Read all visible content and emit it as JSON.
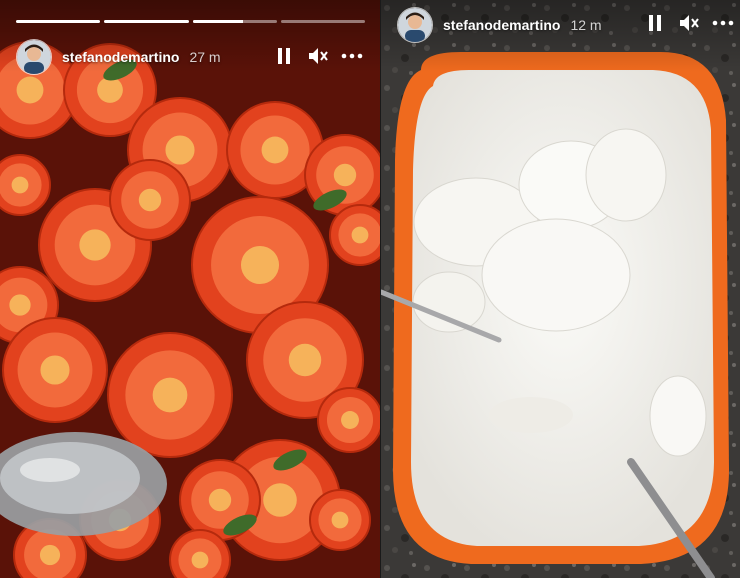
{
  "stories": [
    {
      "username": "stefanodemartino",
      "time_ago": "27 m",
      "progress_segments": [
        1,
        1,
        0.6,
        0
      ],
      "media_description_icon": "tomato-salad-photo",
      "controls": [
        "pause-icon",
        "mute-icon",
        "more-icon"
      ]
    },
    {
      "username": "stefanodemartino",
      "time_ago": "12 m",
      "progress_segments": [],
      "media_description_icon": "mozzarella-bowl-photo",
      "controls": [
        "pause-icon",
        "mute-icon",
        "more-icon"
      ]
    }
  ],
  "colors": {
    "tomato": "#e2421e",
    "bowl_orange": "#f06a1f",
    "mozzarella": "#f2f0ea",
    "granite": "#3a3836"
  }
}
